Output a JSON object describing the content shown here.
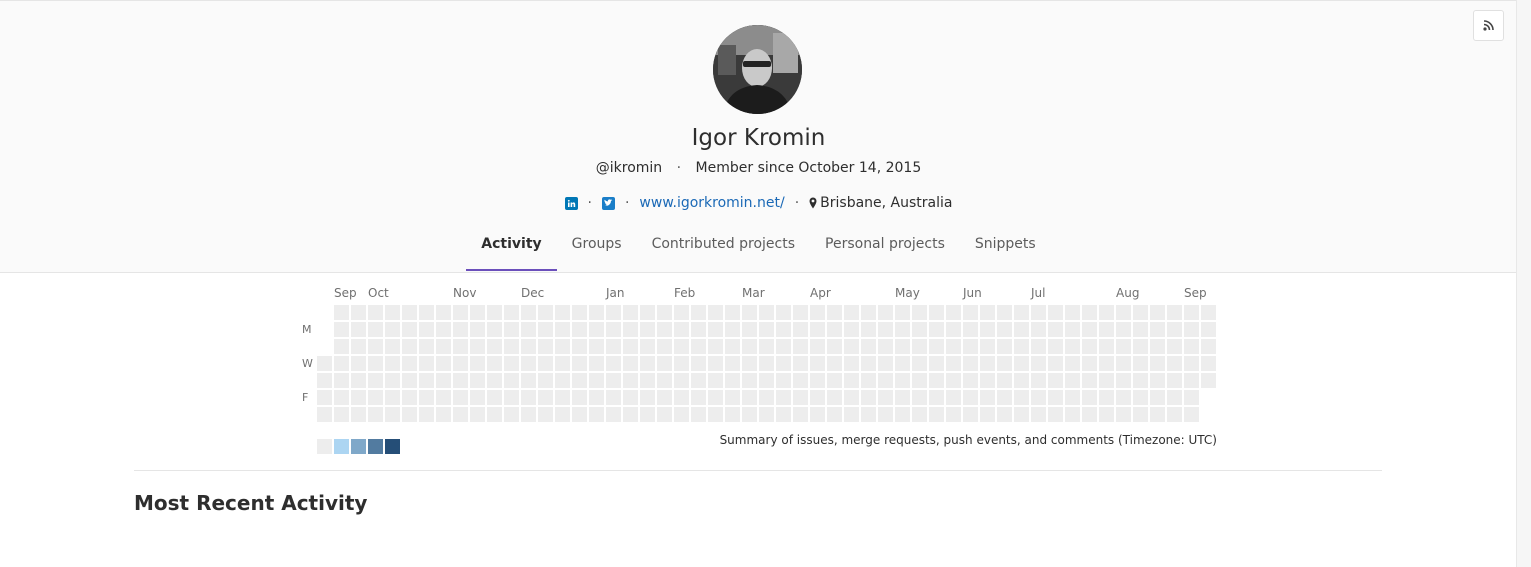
{
  "profile": {
    "name": "Igor Kromin",
    "username": "@ikromin",
    "member_since": "Member since October 14, 2015",
    "website": "www.igorkromin.net/",
    "location": "Brisbane, Australia",
    "linkedin_icon": "linkedin-icon",
    "twitter_icon": "twitter-icon",
    "location_icon": "map-marker-icon",
    "rss_icon": "rss-icon",
    "separator": "·"
  },
  "tabs": [
    {
      "label": "Activity",
      "active": true
    },
    {
      "label": "Groups",
      "active": false
    },
    {
      "label": "Contributed projects",
      "active": false
    },
    {
      "label": "Personal projects",
      "active": false
    },
    {
      "label": "Snippets",
      "active": false
    }
  ],
  "calendar": {
    "months": [
      "Sep",
      "Oct",
      "Nov",
      "Dec",
      "Jan",
      "Feb",
      "Mar",
      "Apr",
      "May",
      "Jun",
      "Jul",
      "Aug",
      "Sep"
    ],
    "month_week_index": [
      1,
      3,
      8,
      12,
      17,
      21,
      25,
      29,
      34,
      38,
      42,
      47,
      51
    ],
    "day_labels": [
      "M",
      "W",
      "F"
    ],
    "weeks": 53,
    "first_week_start_row": 3,
    "last_week_end_row": 4,
    "contributions": "none",
    "legend_colors": [
      "#ededed",
      "#acd5f2",
      "#7fa8c9",
      "#527ba0",
      "#254e77"
    ],
    "empty_color": "#ededed",
    "legend_text": "Summary of issues, merge requests, push events, and comments (Timezone: UTC)"
  },
  "activity": {
    "title": "Most Recent Activity"
  },
  "colors": {
    "accent": "#6b4fbb",
    "link": "#1b69b6",
    "linkedin": "#0077b5",
    "twitter": "#1da1f2"
  }
}
